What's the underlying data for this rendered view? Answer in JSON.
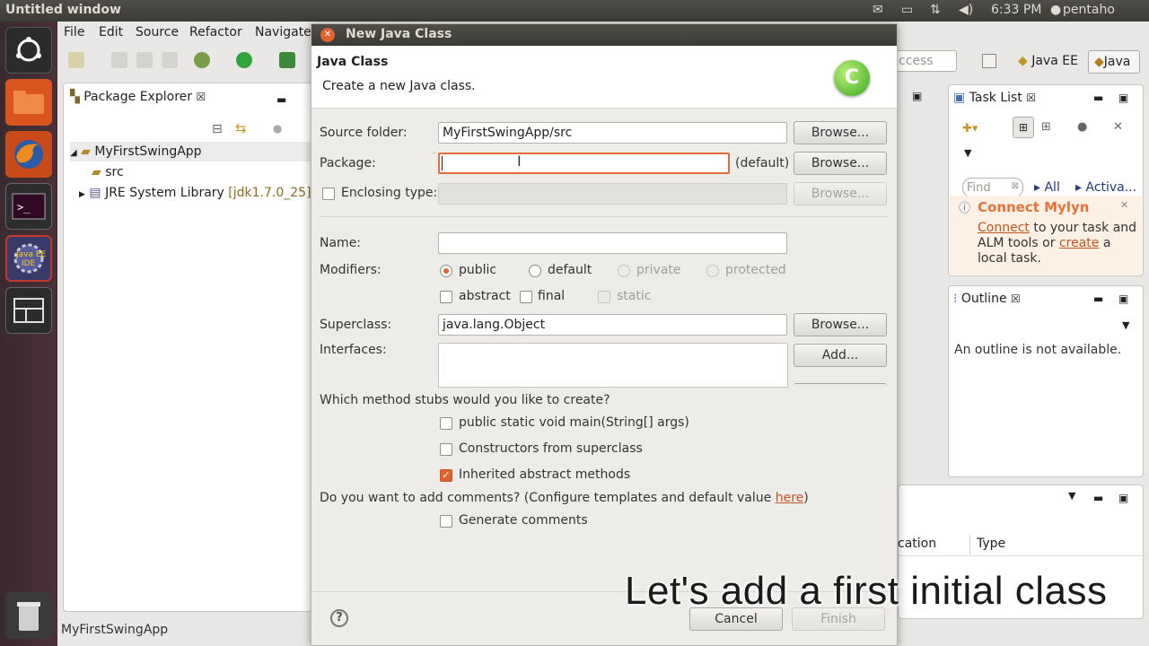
{
  "system": {
    "window_title": "Untitled window",
    "clock": "6:33 PM",
    "user": "pentaho"
  },
  "menubar": {
    "items": [
      "File",
      "Edit",
      "Source",
      "Refactor",
      "Navigate"
    ]
  },
  "perspectives": {
    "quick_access_placeholder": "ccess",
    "java_ee": "Java EE",
    "java": "Java"
  },
  "package_explorer": {
    "tab_title": "Package Explorer",
    "tree": {
      "project": "MyFirstSwingApp",
      "src": "src",
      "jre_label": "JRE System Library",
      "jre_version": "[jdk1.7.0_25]"
    }
  },
  "status_bar": {
    "text": "MyFirstSwingApp"
  },
  "task_list": {
    "tab_title": "Task List",
    "find_placeholder": "Find",
    "all_label": "All",
    "activate_label": "Activa...",
    "mylyn_title": "Connect Mylyn",
    "mylyn_connect_link": "Connect",
    "mylyn_text1": " to your task and",
    "mylyn_text2": "ALM tools or ",
    "mylyn_create_link": "create",
    "mylyn_text3": " a",
    "mylyn_text4": "local task."
  },
  "outline": {
    "tab_title": "Outline",
    "message": "An outline is not available."
  },
  "bottom_panel": {
    "col_location": "cation",
    "col_type": "Type"
  },
  "dialog": {
    "title": "New Java Class",
    "header_title": "Java Class",
    "header_desc": "Create a new Java class.",
    "source_folder_label": "Source folder:",
    "source_folder_value": "MyFirstSwingApp/src",
    "package_label": "Package:",
    "package_value": "",
    "package_default": "(default)",
    "enclosing_label": "Enclosing type:",
    "name_label": "Name:",
    "name_value": "",
    "modifiers_label": "Modifiers:",
    "mod_public": "public",
    "mod_default": "default",
    "mod_private": "private",
    "mod_protected": "protected",
    "mod_abstract": "abstract",
    "mod_final": "final",
    "mod_static": "static",
    "superclass_label": "Superclass:",
    "superclass_value": "java.lang.Object",
    "interfaces_label": "Interfaces:",
    "browse": "Browse...",
    "add": "Add...",
    "stubs_question": "Which method stubs would you like to create?",
    "stub_main": "public static void main(String[] args)",
    "stub_constructors": "Constructors from superclass",
    "stub_inherited": "Inherited abstract methods",
    "comments_question_pre": "Do you want to add comments? (Configure templates and default value ",
    "comments_here": "here",
    "comments_question_post": ")",
    "generate_comments": "Generate comments",
    "cancel": "Cancel",
    "finish": "Finish"
  },
  "caption": "Let's add a first initial class"
}
